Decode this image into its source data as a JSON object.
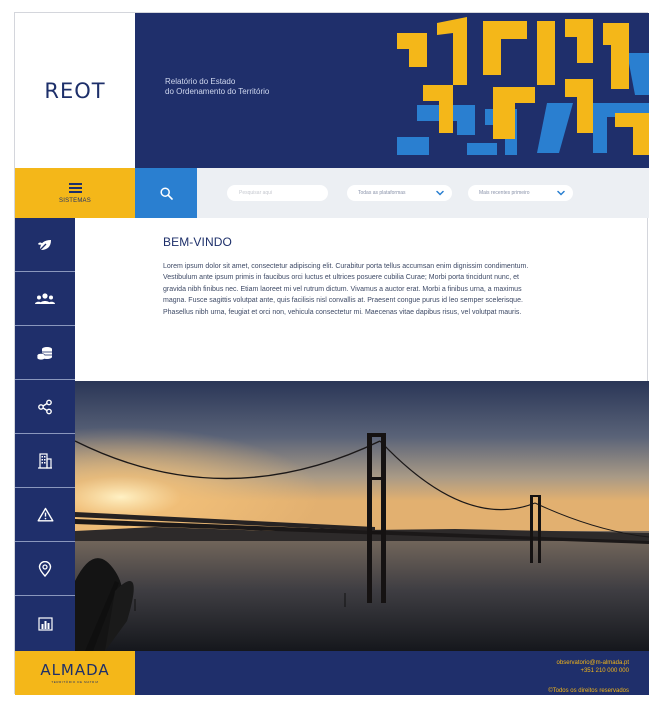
{
  "brand": {
    "logo": "REOT",
    "title_line1": "Relatório do Estado",
    "title_line2": "do Ordenamento do Território"
  },
  "nav": {
    "menu_label": "SISTEMAS"
  },
  "filters": {
    "search_placeholder": "Pesquisar aqui",
    "select_1": "Todas as plataformas",
    "select_2": "Mais recentes primeiro"
  },
  "sidebar": {
    "items": [
      {
        "icon": "leaf-icon"
      },
      {
        "icon": "people-icon"
      },
      {
        "icon": "coins-icon"
      },
      {
        "icon": "share-icon"
      },
      {
        "icon": "building-icon"
      },
      {
        "icon": "warning-icon"
      },
      {
        "icon": "location-pin-icon"
      },
      {
        "icon": "bar-chart-icon"
      }
    ]
  },
  "welcome": {
    "heading": "BEM-VINDO",
    "body": "Lorem ipsum dolor sit amet, consectetur adipiscing elit. Curabitur porta tellus accumsan enim dignissim condimentum. Vestibulum ante ipsum primis in faucibus orci luctus et ultrices posuere cubilia Curae; Morbi porta tincidunt nunc, et gravida nibh finibus nec. Etiam laoreet mi vel rutrum dictum. Vivamus a auctor erat. Morbi a finibus urna, a maximus magna. Fusce sagittis volutpat ante, quis facilisis nisl convallis at. Praesent congue purus id leo semper scelerisque. Phasellus nibh urna, feugiat et orci non, vehicula consectetur mi. Maecenas vitae dapibus risus, vel volutpat mauris."
  },
  "footer": {
    "logo": "ALMADA",
    "logo_sub": "TERRITÓRIO DE MATRIZ",
    "email": "observatorio@m-almada.pt",
    "phone": "+351 210 000 000",
    "copyright": "©Todos os direitos reservados"
  },
  "colors": {
    "navy": "#1f2f6b",
    "yellow": "#f4b719",
    "blue": "#2a7fd0",
    "bar_bg": "#eceff3"
  }
}
